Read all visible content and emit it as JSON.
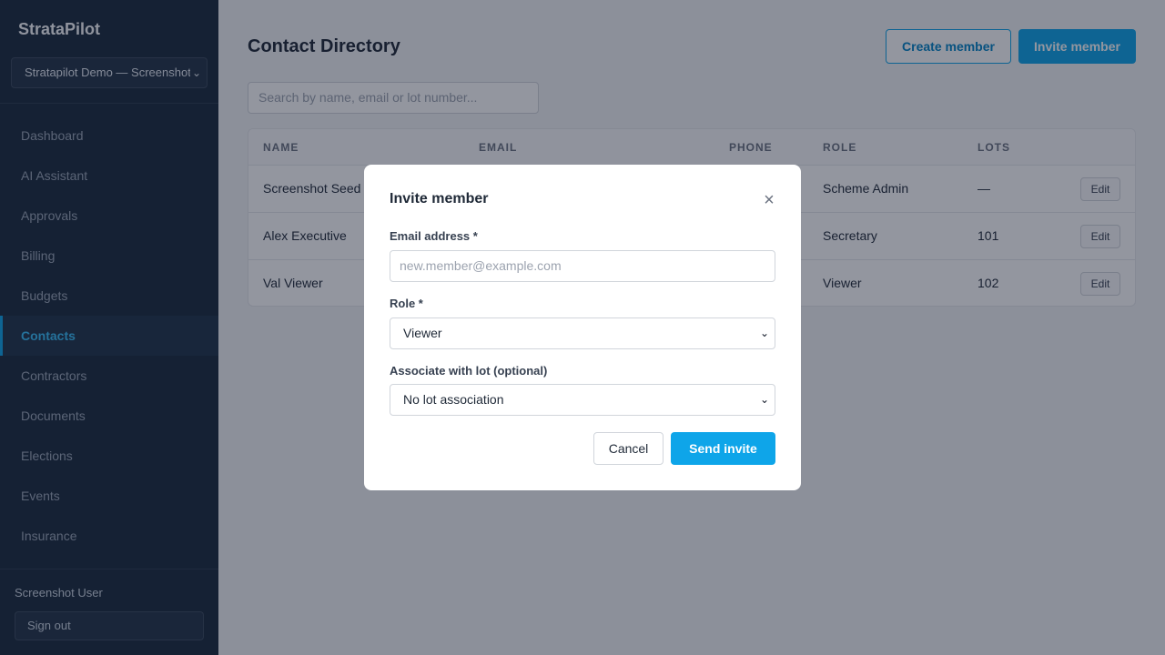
{
  "sidebar": {
    "brand": "StrataPilot",
    "org_select": "Stratapilot Demo — Screenshot",
    "nav": [
      "Dashboard",
      "AI Assistant",
      "Approvals",
      "Billing",
      "Budgets",
      "Contacts",
      "Contractors",
      "Documents",
      "Elections",
      "Events",
      "Insurance"
    ],
    "active_item": "Contacts",
    "user_name": "Screenshot User",
    "sign_out": "Sign out"
  },
  "page": {
    "title": "Contact Directory",
    "create_member": "Create member",
    "invite_member": "Invite member",
    "search_placeholder": "Search by name, email or lot number..."
  },
  "table": {
    "columns": [
      "NAME",
      "EMAIL",
      "PHONE",
      "ROLE",
      "LOTS"
    ],
    "rows": [
      {
        "name": "Screenshot Seed",
        "email": "",
        "phone": "",
        "role": "Scheme Admin",
        "lots": "—",
        "action": "Edit"
      },
      {
        "name": "Alex Executive",
        "email": "",
        "phone": "",
        "role": "Secretary",
        "lots": "101",
        "action": "Edit"
      },
      {
        "name": "Val Viewer",
        "email": "",
        "phone": "",
        "role": "Viewer",
        "lots": "102",
        "action": "Edit"
      }
    ]
  },
  "modal": {
    "title": "Invite member",
    "close": "×",
    "email_label": "Email address *",
    "email_placeholder": "new.member@example.com",
    "role_label": "Role *",
    "role_value": "Viewer",
    "lot_label": "Associate with lot (optional)",
    "lot_value": "No lot association",
    "cancel": "Cancel",
    "send": "Send invite"
  },
  "colors": {
    "accent": "#0ea5e9",
    "sidebar_bg": "#1b2a3c"
  }
}
